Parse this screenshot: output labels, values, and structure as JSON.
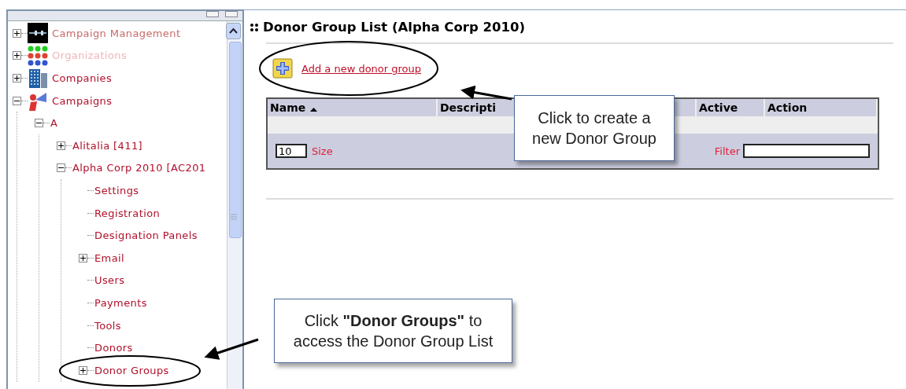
{
  "sidebar": {
    "tree": [
      {
        "label": "Campaign Management",
        "kind": "network",
        "color": "#c86a6a",
        "expanded": false
      },
      {
        "label": "Organizations",
        "kind": "people",
        "color": "#f0b6b6",
        "expanded": false
      },
      {
        "label": "Companies",
        "kind": "building",
        "color": "#b0102a",
        "expanded": false
      },
      {
        "label": "Campaigns",
        "kind": "megaphone",
        "color": "#b0102a",
        "expanded": true,
        "children": [
          {
            "label": "A",
            "color": "#b0102a",
            "expanded": true,
            "children": [
              {
                "label": "Alitalia [411]",
                "color": "#b0102a",
                "expanded": false
              },
              {
                "label": "Alpha Corp 2010 [AC201",
                "color": "#b0102a",
                "expanded": true,
                "children": [
                  {
                    "label": "Settings",
                    "color": "#b0102a"
                  },
                  {
                    "label": "Registration",
                    "color": "#b0102a"
                  },
                  {
                    "label": "Designation Panels",
                    "color": "#b0102a"
                  },
                  {
                    "label": "Email",
                    "color": "#b0102a",
                    "expanded": false
                  },
                  {
                    "label": "Users",
                    "color": "#b0102a"
                  },
                  {
                    "label": "Payments",
                    "color": "#b0102a"
                  },
                  {
                    "label": "Tools",
                    "color": "#b0102a"
                  },
                  {
                    "label": "Donors",
                    "color": "#b0102a"
                  },
                  {
                    "label": "Donor Groups",
                    "color": "#b0102a",
                    "expanded": false
                  }
                ]
              }
            ]
          }
        ]
      }
    ]
  },
  "content": {
    "title": "Donor Group List (Alpha Corp 2010)",
    "add_link": "Add a new donor group",
    "table": {
      "columns": [
        {
          "label": "Name",
          "sorted": true
        },
        {
          "label": "Descripti",
          "sorted": false
        },
        {
          "label": "Active",
          "sorted": false
        },
        {
          "label": "Action",
          "sorted": false
        }
      ],
      "page_size": "10",
      "size_label": "Size",
      "filter_label": "Filter"
    }
  },
  "callouts": [
    {
      "text": "Click to create a new Donor Group"
    },
    {
      "text": "Click **\"Donor Groups\"** to access the Donor Group List"
    }
  ]
}
